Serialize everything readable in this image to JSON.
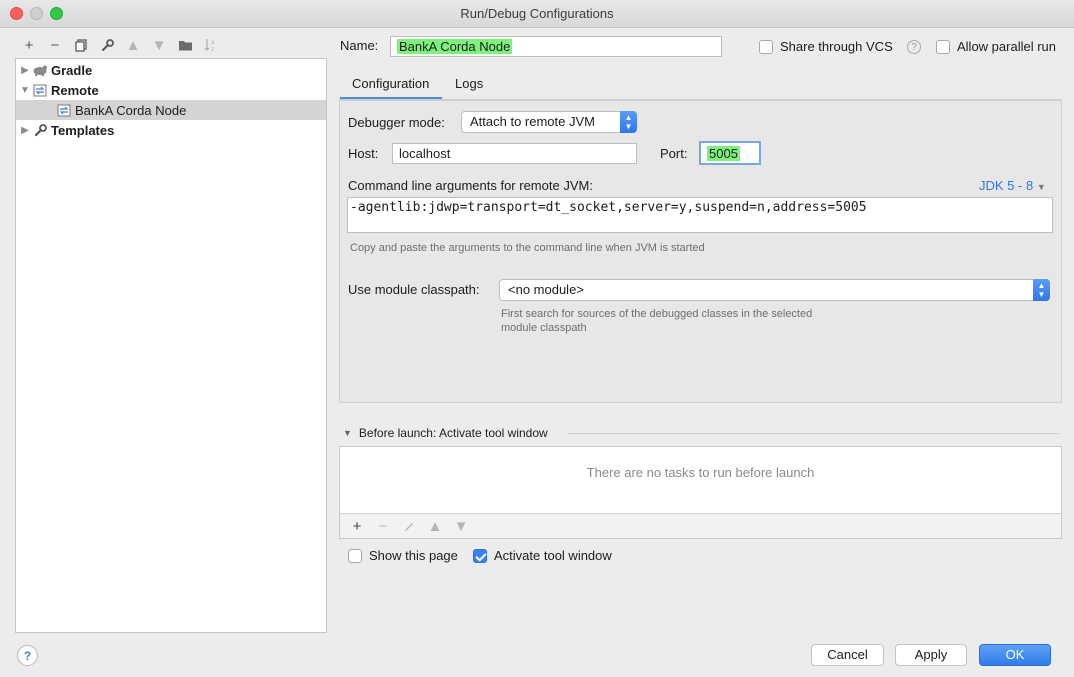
{
  "window": {
    "title": "Run/Debug Configurations"
  },
  "toolbar": {
    "items": [
      "add-icon",
      "remove-icon",
      "copy-icon",
      "wrench-icon",
      "move-up-icon",
      "move-down-icon",
      "folder-icon",
      "sort-icon"
    ]
  },
  "tree": {
    "gradle": "Gradle",
    "remote": "Remote",
    "bank_node": "BankA Corda Node",
    "templates": "Templates"
  },
  "name_row": {
    "label": "Name:",
    "value": "BankA Corda Node",
    "share_vcs": "Share through VCS",
    "share_vcs_checked": false,
    "allow_parallel": "Allow parallel run",
    "allow_parallel_checked": false
  },
  "tabs": {
    "configuration": "Configuration",
    "logs": "Logs",
    "active": "Configuration"
  },
  "config": {
    "debugger_mode_label": "Debugger mode:",
    "debugger_mode_value": "Attach to remote JVM",
    "host_label": "Host:",
    "host_value": "localhost",
    "port_label": "Port:",
    "port_value": "5005",
    "cmd_label": "Command line arguments for remote JVM:",
    "jdk_link": "JDK 5 - 8",
    "cmd_value": "-agentlib:jdwp=transport=dt_socket,server=y,suspend=n,address=5005",
    "cmd_hint": "Copy and paste the arguments to the command line when JVM is started",
    "module_label": "Use module classpath:",
    "module_value": "<no module>",
    "module_hint_1": "First search for sources of the debugged classes in the selected",
    "module_hint_2": "module classpath"
  },
  "before_launch": {
    "title": "Before launch: Activate tool window",
    "empty": "There are no tasks to run before launch"
  },
  "options": {
    "show_page": "Show this page",
    "show_page_checked": false,
    "activate_tool": "Activate tool window",
    "activate_tool_checked": true
  },
  "buttons": {
    "cancel": "Cancel",
    "apply": "Apply",
    "ok": "OK"
  },
  "colors": {
    "accent": "#3b82f6",
    "highlight": "#7cf27c",
    "link": "#2e76e8"
  }
}
